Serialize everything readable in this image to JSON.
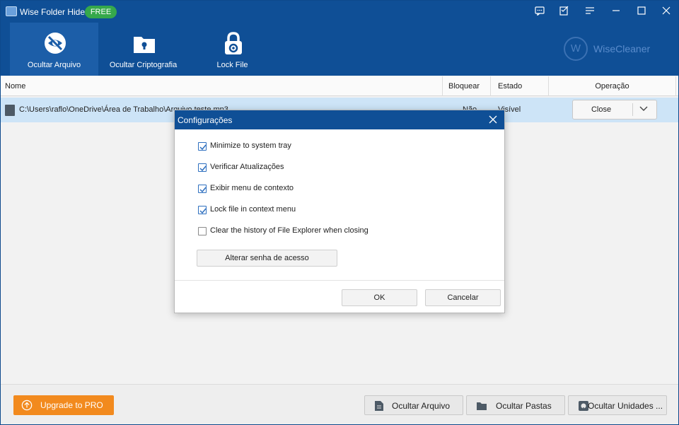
{
  "app": {
    "title": "Wise Folder Hider",
    "badge": "FREE",
    "brand_mark": "W",
    "brand_name": "WiseCleaner",
    "colors": {
      "header": "#0f4f96",
      "badge": "#35a84b",
      "upgrade": "#f28a1e",
      "row_selected": "#cde4f7"
    }
  },
  "titlebar_icons": [
    "chat-icon",
    "feedback-icon",
    "menu-icon",
    "minimize-icon",
    "maximize-icon",
    "close-icon"
  ],
  "tabs": [
    {
      "label": "Ocultar Arquivo",
      "icon": "eye-hidden-icon",
      "active": true
    },
    {
      "label": "Ocultar Criptografia",
      "icon": "folder-lock-icon",
      "active": false
    },
    {
      "label": "Lock File",
      "icon": "padlock-icon",
      "active": false
    }
  ],
  "table": {
    "headers": {
      "name": "Nome",
      "lock": "Bloquear",
      "state": "Estado",
      "operation": "Operação"
    },
    "rows": [
      {
        "path": "C:\\Users\\raflo\\OneDrive\\Área de Trabalho\\Arquivo teste.mp3",
        "lock": "Não",
        "state": "Visível",
        "operation": "Close"
      }
    ]
  },
  "dialog": {
    "title": "Configurações",
    "options": [
      {
        "label": "Minimize to system tray",
        "checked": true
      },
      {
        "label": "Verificar Atualizações",
        "checked": true
      },
      {
        "label": "Exibir menu de contexto",
        "checked": true
      },
      {
        "label": "Lock file in context menu",
        "checked": true
      },
      {
        "label": "Clear the history of File Explorer when closing",
        "checked": false
      }
    ],
    "password_button": "Alterar senha de acesso",
    "ok": "OK",
    "cancel": "Cancelar"
  },
  "footer": {
    "upgrade": "Upgrade to PRO",
    "hide_file": "Ocultar Arquivo",
    "hide_folders": "Ocultar Pastas",
    "hide_drives": "Ocultar Unidades ..."
  }
}
